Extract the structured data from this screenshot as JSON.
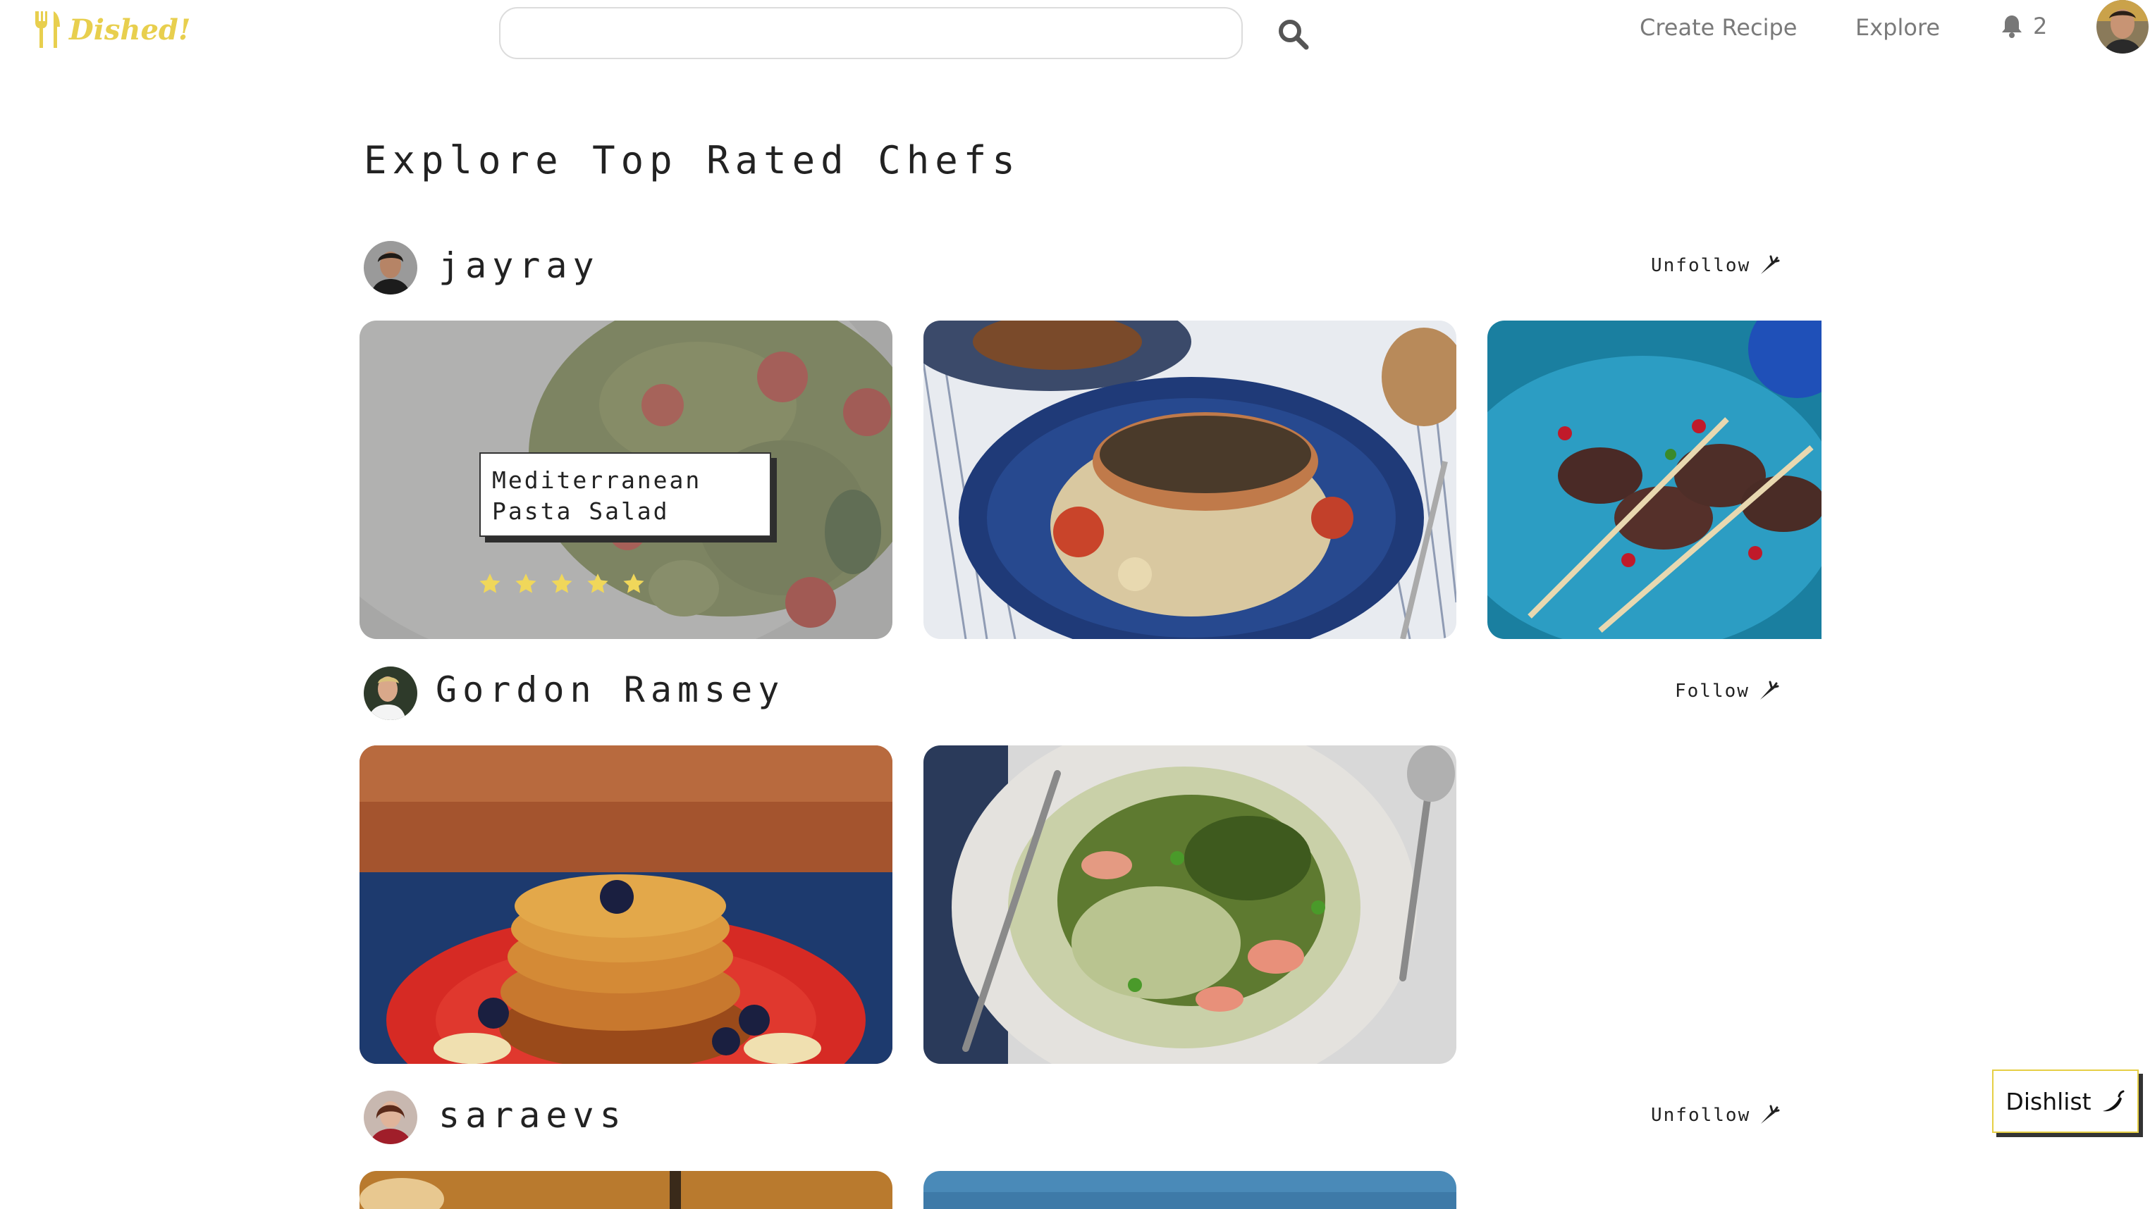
{
  "nav": {
    "logo_text": "Dished!",
    "search": {
      "value": "",
      "placeholder": ""
    },
    "links": {
      "create": "Create Recipe",
      "explore": "Explore"
    },
    "notifications_count": "2"
  },
  "page": {
    "title": "Explore Top Rated Chefs"
  },
  "chefs": [
    {
      "name": "jayray",
      "follow_label": "Unfollow",
      "recipes": [
        {
          "title": "Mediterranean Pasta Salad",
          "rating": 5,
          "max_rating": 5
        }
      ]
    },
    {
      "name": "Gordon Ramsey",
      "follow_label": "Follow"
    },
    {
      "name": "saraevs",
      "follow_label": "Unfollow"
    }
  ],
  "dishlist": {
    "label": "Dishlist"
  },
  "colors": {
    "brand": "#e8cf4e",
    "star": "#f0d75a",
    "nav_text": "#7a7a7a"
  },
  "icons": [
    "fork-knife-icon",
    "search-icon",
    "bell-icon",
    "carrot-icon",
    "chili-pepper-icon",
    "star-icon"
  ]
}
